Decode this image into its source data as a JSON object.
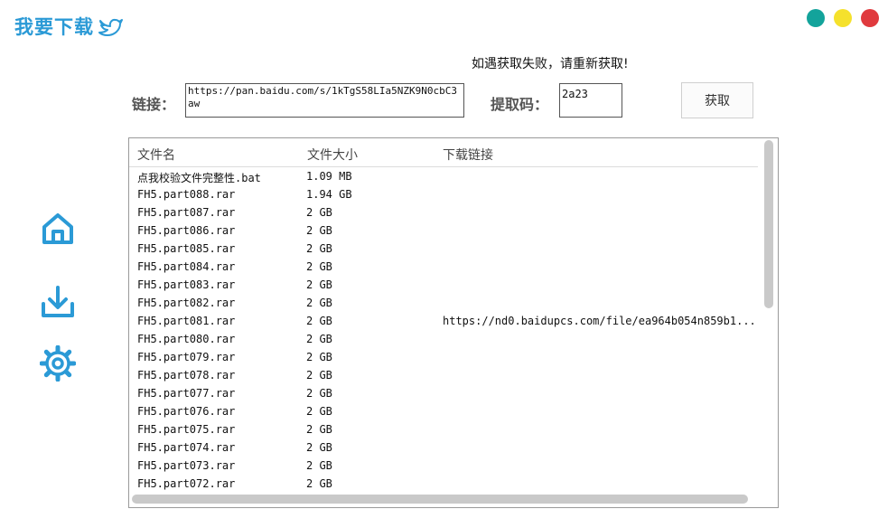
{
  "app": {
    "title": "我要下载"
  },
  "window": {
    "dot_colors": [
      "#13a39b",
      "#f5e12c",
      "#e03a3e"
    ]
  },
  "notice": "如遇获取失败，请重新获取!",
  "form": {
    "link_label": "链接：",
    "link_value": "https://pan.baidu.com/s/1kTgS58LIa5NZK9N0cbC3aw",
    "code_label": "提取码：",
    "code_value": "2a23",
    "fetch_button": "获取"
  },
  "nav": {
    "items": [
      {
        "icon": "home-icon"
      },
      {
        "icon": "download-icon"
      },
      {
        "icon": "gear-icon"
      }
    ],
    "accent": "#2b9ad6"
  },
  "table": {
    "headers": {
      "name": "文件名",
      "size": "文件大小",
      "link": "下载链接"
    },
    "rows": [
      {
        "name": "点我校验文件完整性.bat",
        "size": "1.09 MB",
        "link": ""
      },
      {
        "name": "FH5.part088.rar",
        "size": "1.94 GB",
        "link": ""
      },
      {
        "name": "FH5.part087.rar",
        "size": "2 GB",
        "link": ""
      },
      {
        "name": "FH5.part086.rar",
        "size": "2 GB",
        "link": ""
      },
      {
        "name": "FH5.part085.rar",
        "size": "2 GB",
        "link": ""
      },
      {
        "name": "FH5.part084.rar",
        "size": "2 GB",
        "link": ""
      },
      {
        "name": "FH5.part083.rar",
        "size": "2 GB",
        "link": ""
      },
      {
        "name": "FH5.part082.rar",
        "size": "2 GB",
        "link": ""
      },
      {
        "name": "FH5.part081.rar",
        "size": "2 GB",
        "link": "https://nd0.baidupcs.com/file/ea964b054n859b1..."
      },
      {
        "name": "FH5.part080.rar",
        "size": "2 GB",
        "link": ""
      },
      {
        "name": "FH5.part079.rar",
        "size": "2 GB",
        "link": ""
      },
      {
        "name": "FH5.part078.rar",
        "size": "2 GB",
        "link": ""
      },
      {
        "name": "FH5.part077.rar",
        "size": "2 GB",
        "link": ""
      },
      {
        "name": "FH5.part076.rar",
        "size": "2 GB",
        "link": ""
      },
      {
        "name": "FH5.part075.rar",
        "size": "2 GB",
        "link": ""
      },
      {
        "name": "FH5.part074.rar",
        "size": "2 GB",
        "link": ""
      },
      {
        "name": "FH5.part073.rar",
        "size": "2 GB",
        "link": ""
      },
      {
        "name": "FH5.part072.rar",
        "size": "2 GB",
        "link": ""
      }
    ]
  }
}
